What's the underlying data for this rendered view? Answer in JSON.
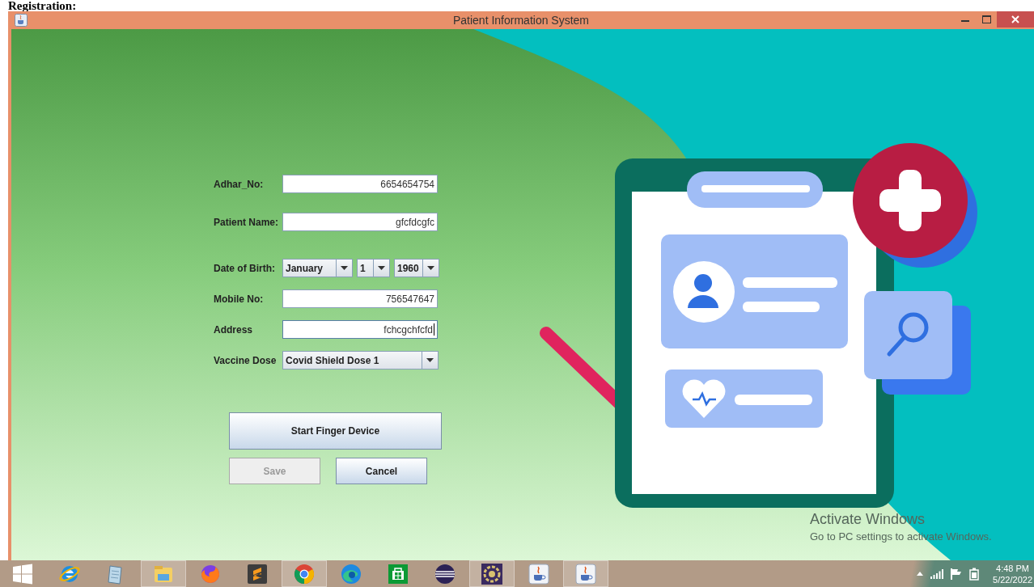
{
  "page_heading": "Registration:",
  "window": {
    "title": "Patient Information System"
  },
  "form": {
    "fields": [
      {
        "kind": "text",
        "label": "Adhar_No:",
        "value": "6654654754",
        "focused": false
      },
      {
        "kind": "text",
        "label": "Patient Name:",
        "value": "gfcfdcgfc",
        "focused": false
      },
      {
        "kind": "date",
        "label": "Date of Birth:",
        "selects": [
          "January",
          "1",
          "1960"
        ]
      },
      {
        "kind": "text",
        "label": "Mobile No:",
        "value": "756547647",
        "focused": false
      },
      {
        "kind": "text",
        "label": "Address",
        "value": "fchcgchfcfd",
        "focused": true
      },
      {
        "kind": "select",
        "label": "Vaccine Dose",
        "value": "Covid Shield Dose 1"
      }
    ]
  },
  "buttons": [
    {
      "kind": "wide",
      "label": "Start Finger Device",
      "disabled": false
    },
    {
      "kind": "small",
      "label": "Save",
      "disabled": true
    },
    {
      "kind": "small",
      "label": "Cancel",
      "disabled": false
    }
  ],
  "activation_notice": {
    "title": "Activate Windows",
    "subtitle": "Go to PC settings to activate Windows."
  },
  "taskbar": {
    "apps": [
      {
        "kind": "start",
        "running": false
      },
      {
        "kind": "ie",
        "running": false
      },
      {
        "kind": "notepad",
        "running": false
      },
      {
        "kind": "explorer",
        "running": true
      },
      {
        "kind": "firefox",
        "running": false
      },
      {
        "kind": "sublime",
        "running": false
      },
      {
        "kind": "chrome",
        "running": true
      },
      {
        "kind": "edge",
        "running": false
      },
      {
        "kind": "store",
        "running": false
      },
      {
        "kind": "eclipse",
        "running": false
      },
      {
        "kind": "javaee",
        "running": true
      },
      {
        "kind": "java",
        "running": false
      },
      {
        "kind": "java",
        "running": true
      }
    ],
    "clock": {
      "time": "4:48 PM",
      "date": "5/22/2022"
    }
  }
}
